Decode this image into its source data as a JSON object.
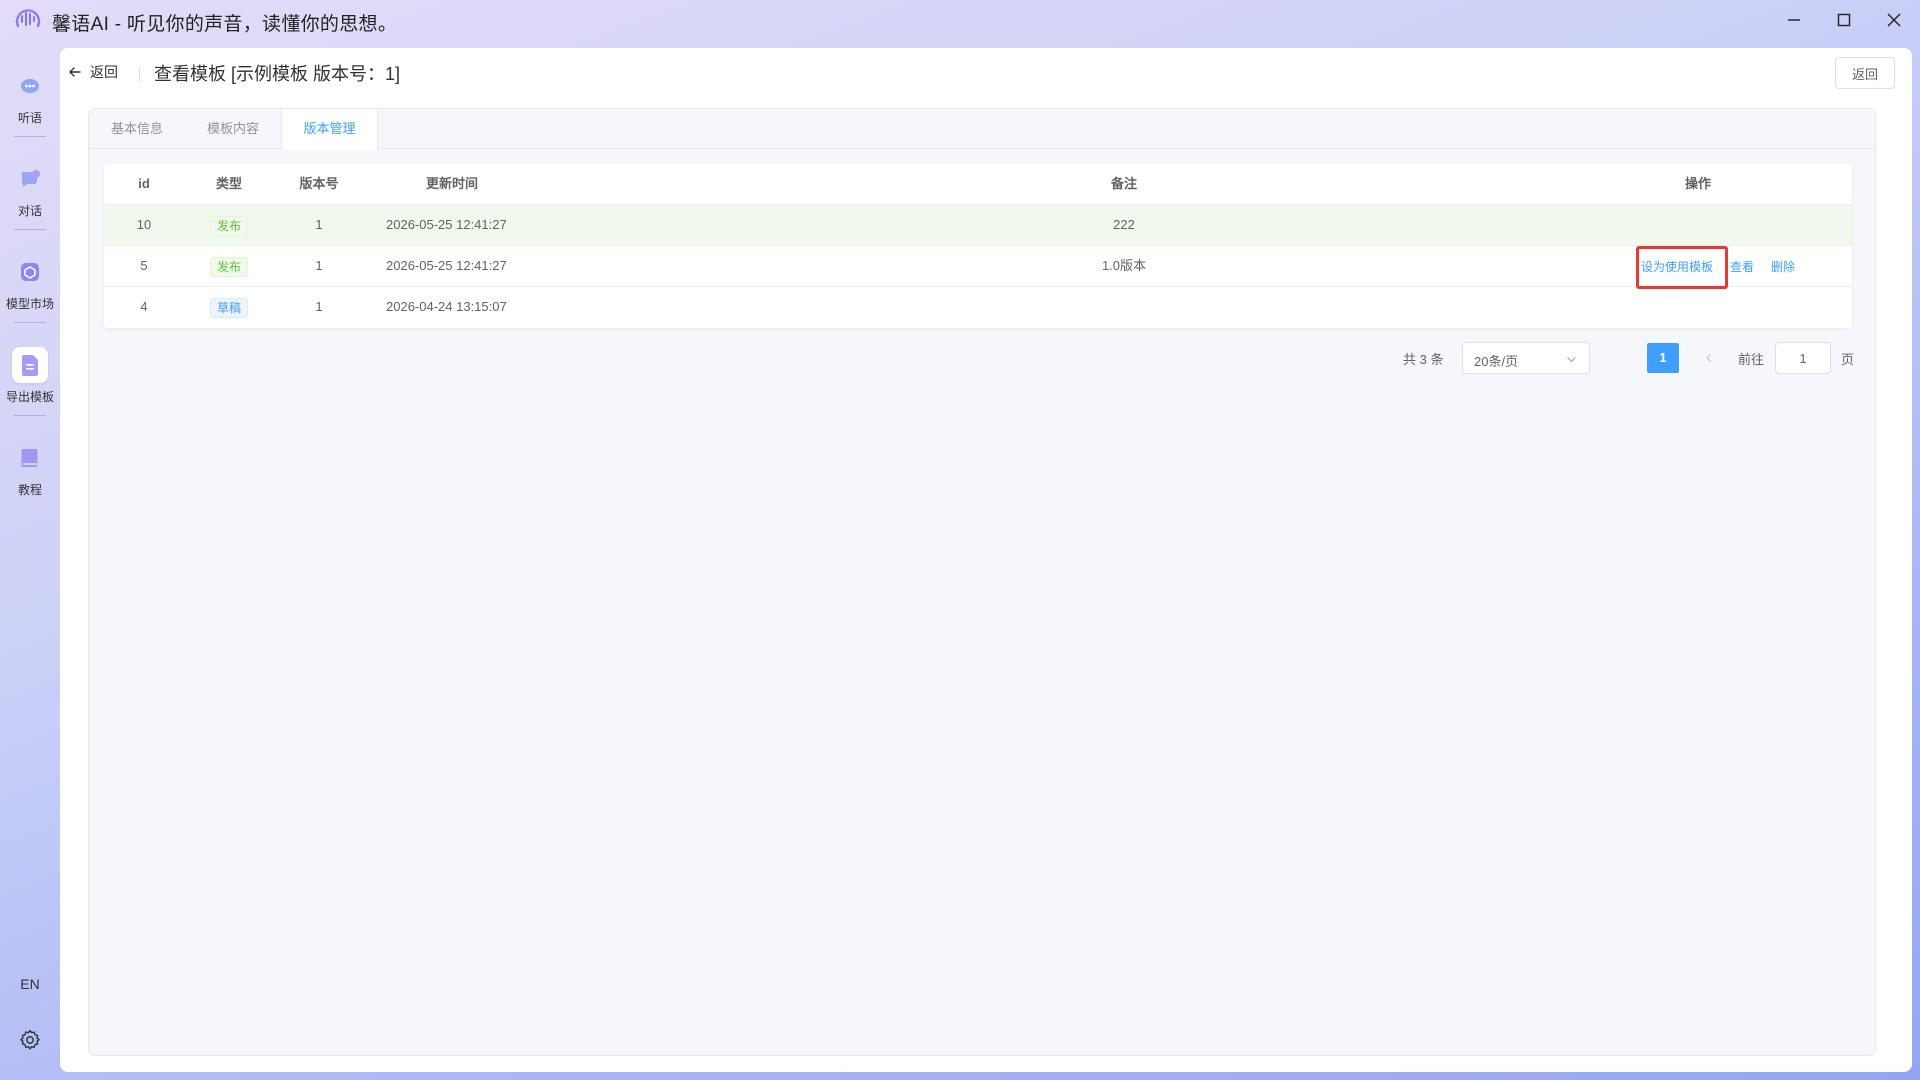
{
  "window": {
    "title": "馨语AI - 听见你的声音，读懂你的思想。"
  },
  "sidebar": {
    "items": [
      {
        "label": "听语",
        "icon": "listen-icon"
      },
      {
        "label": "对话",
        "icon": "chat-icon"
      },
      {
        "label": "模型市场",
        "icon": "model-market-icon"
      },
      {
        "label": "导出模板",
        "icon": "export-template-icon",
        "active": true
      },
      {
        "label": "教程",
        "icon": "tutorial-book-icon"
      }
    ],
    "language": "EN"
  },
  "header": {
    "back_label": "返回",
    "title": "查看模板 [示例模板 版本号：1]",
    "return_button": "返回"
  },
  "tabs": [
    {
      "label": "基本信息"
    },
    {
      "label": "模板内容"
    },
    {
      "label": "版本管理",
      "active": true
    }
  ],
  "table": {
    "columns": [
      "id",
      "类型",
      "版本号",
      "更新时间",
      "备注",
      "操作"
    ],
    "rows": [
      {
        "id": "10",
        "type": "发布",
        "version": "1",
        "time": "2026-05-25 12:41:27",
        "note": "222"
      },
      {
        "id": "5",
        "type": "发布",
        "version": "1",
        "time": "2026-05-25 12:41:27",
        "note": "1.0版本",
        "actions": [
          "设为使用模板",
          "查看",
          "删除"
        ]
      },
      {
        "id": "4",
        "type": "草稿",
        "version": "1",
        "time": "2026-04-24 13:15:07",
        "note": ""
      }
    ]
  },
  "pagination": {
    "total_text": "共 3 条",
    "page_size": "20条/页",
    "current_page": "1",
    "goto_label": "前往",
    "goto_value": "1",
    "page_unit": "页"
  },
  "colors": {
    "primary": "#409eff",
    "success": "#67c23a",
    "highlight_row": "#f0f9eb",
    "annotation_box": "#e53935"
  }
}
